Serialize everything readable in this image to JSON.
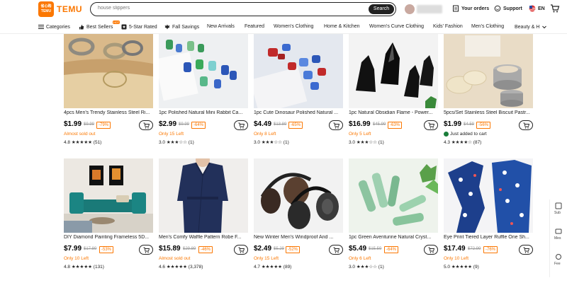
{
  "brand": {
    "logo_line1": "省心购",
    "logo_line2": "TEMU",
    "name": "TEMU"
  },
  "search": {
    "placeholder": "house slippers",
    "button": "Search"
  },
  "header": {
    "orders": "Your orders",
    "support": "Support",
    "language": "EN"
  },
  "nav": [
    "Categories",
    "Best Sellers",
    "5-Star Rated",
    "Fall Savings",
    "New Arrivals",
    "Featured",
    "Women's Clothing",
    "Home & Kitchen",
    "Women's Curve Clothing",
    "Kids' Fashion",
    "Men's Clothing",
    "Beauty & H"
  ],
  "nav_hot": "HOT",
  "products": [
    {
      "title": "4pcs Men's Trendy Stainless Steel Ri...",
      "price": "$1.99",
      "old": "$9.99",
      "discount": "-79%",
      "stock": "Almost sold out",
      "rating": "4.8 ★★★★★ (51)"
    },
    {
      "title": "1pc Polished Natural Mini Rabbit Ca...",
      "price": "$2.99",
      "old": "$9.99",
      "discount": "-64%",
      "stock": "Only 15 Left",
      "rating": "3.0 ★★★☆☆ (1)"
    },
    {
      "title": "1pc Cute Dinosaur Polished Natural ...",
      "price": "$4.49",
      "old": "$13.89",
      "discount": "-65%",
      "stock": "Only 8 Left",
      "rating": "3.0 ★★★☆☆ (1)"
    },
    {
      "title": "1pc Natural Obsidian Flame - Power...",
      "price": "$16.99",
      "old": "$45.99",
      "discount": "-63%",
      "stock": "Only 5 Left",
      "rating": "3.0 ★★★☆☆ (1)"
    },
    {
      "title": "5pcs/Set Stainless Steel Biscuit Pastr...",
      "price": "$1.99",
      "old": "$4.59",
      "discount": "-56%",
      "stock": "Just added to cart",
      "rating": "4.3 ★★★★☆ (87)"
    },
    {
      "title": "DIY Diamond Painting Frameless 5D...",
      "price": "$7.99",
      "old": "$17.89",
      "discount": "-53%",
      "stock": "Only 10 Left",
      "rating": "4.8 ★★★★★ (131)"
    },
    {
      "title": "Men's Comfy Waffle Pattern Robe F...",
      "price": "$15.89",
      "old": "$29.89",
      "discount": "-46%",
      "stock": "Almost sold out",
      "rating": "4.6 ★★★★★ (3,378)"
    },
    {
      "title": "New Winter Men's Windproof And ...",
      "price": "$2.49",
      "old": "$5.29",
      "discount": "-52%",
      "stock": "Only 15 Left",
      "rating": "4.7 ★★★★★ (89)"
    },
    {
      "title": "1pc Green Aventurine Natural Cryst...",
      "price": "$5.49",
      "old": "$15.59",
      "discount": "-64%",
      "stock": "Only 6 Left",
      "rating": "3.0 ★★★☆☆ (1)"
    },
    {
      "title": "Eye Print Tiered Layer Ruffle One Sh...",
      "price": "$17.49",
      "old": "$72.99",
      "discount": "-76%",
      "stock": "Only 10 Left",
      "rating": "5.0 ★★★★★ (9)"
    }
  ],
  "rail": [
    "Sub",
    "Mes",
    "Fee"
  ],
  "colors": {
    "accent": "#fb7701",
    "text": "#222222"
  }
}
